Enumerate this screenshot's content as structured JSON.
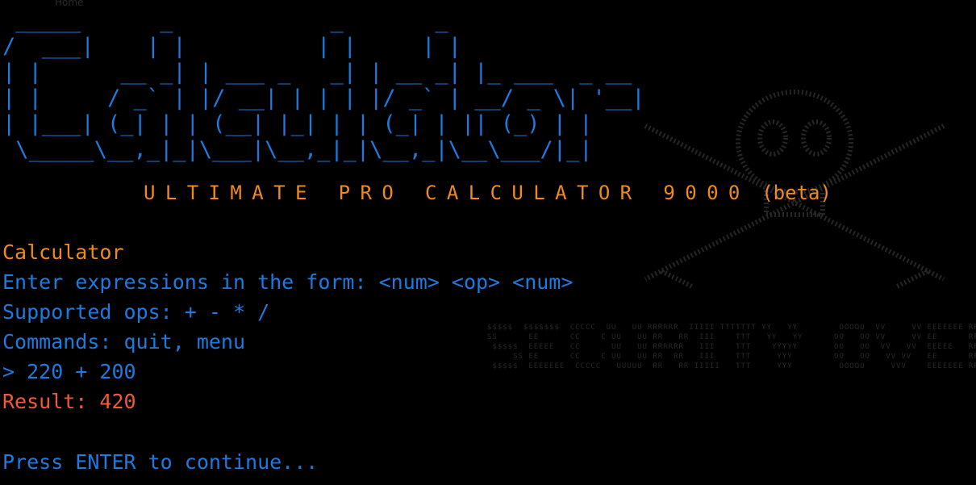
{
  "background": {
    "home_link": "Home",
    "skull_icon": "skull-crossbones-icon",
    "banner_icon": "faded-ascii-banner-icon"
  },
  "logo": {
    "ascii": " _____      _            _       _\n/  ___|    | |          | |     | |\n| |      __ _| | ___ _   _| | __ _| |_ ___  _ __\n| |     / _` | |/ __| | | | |/ _` | __/ _ \\| '__|\n| |___| (_| | | (__| |_| | | (_| | || (_) | |\n \\_____\\__,_|_|\\___|\\__,_|_|\\__,_|\\__\\___/|_|"
  },
  "tagline": {
    "main": "ULTIMATE PRO CALCULATOR 9000",
    "beta": " (beta)"
  },
  "terminal": {
    "title": "Calculator",
    "line_form": "Enter expressions in the form: <num> <op> <num>",
    "line_ops": "Supported ops: + - * /",
    "line_commands": "Commands: quit, menu",
    "input_line": "> 220 + 200",
    "result_line": "Result: 420",
    "continue_prompt": "Press ENTER to continue..."
  },
  "colors": {
    "background": "#000000",
    "blue": "#1f7ae0",
    "orange": "#f08a1f",
    "red": "#f05a3a"
  }
}
